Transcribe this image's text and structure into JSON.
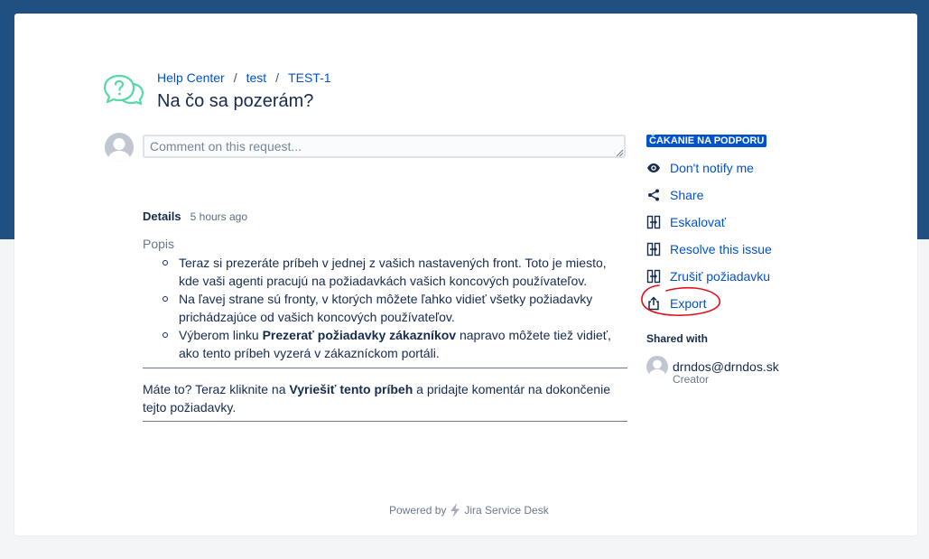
{
  "breadcrumb": {
    "items": [
      "Help Center",
      "test",
      "TEST-1"
    ],
    "separator": "/"
  },
  "page": {
    "title": "Na čo sa pozerám?"
  },
  "comment": {
    "placeholder": "Comment on this request..."
  },
  "details": {
    "title": "Details",
    "time": "5 hours ago",
    "field_label": "Popis",
    "bullets": [
      {
        "text": "Teraz si prezeráte príbeh v jednej z vašich nastavených front. Toto je miesto, kde vaši agenti pracujú na požiadavkách vašich koncových používateľov."
      },
      {
        "text": "Na ľavej strane sú fronty, v ktorých môžete ľahko vidieť všetky požiadavky prichádzajúce od vašich koncových používateľov."
      },
      {
        "before": "Výberom linku ",
        "bold": "Prezerať požiadavky zákazníkov",
        "after": " napravo môžete tiež vidieť, ako tento príbeh vyzerá v zákazníckom portáli."
      }
    ],
    "closing": {
      "before": "Máte to? Teraz kliknite na ",
      "bold": "Vyriešiť tento príbeh",
      "after": " a pridajte komentár na dokončenie tejto požiadavky."
    }
  },
  "sidebar": {
    "status": "ČAKANIE NA PODPORU",
    "actions": [
      {
        "label": "Don't notify me",
        "icon": "eye-icon"
      },
      {
        "label": "Share",
        "icon": "share-icon"
      },
      {
        "label": "Eskalovať",
        "icon": "transition-icon"
      },
      {
        "label": "Resolve this issue",
        "icon": "transition-icon"
      },
      {
        "label": "Zrušiť požiadavku",
        "icon": "transition-icon"
      },
      {
        "label": "Export",
        "icon": "export-icon"
      }
    ],
    "shared_with": {
      "title": "Shared with",
      "email": "drndos@drndos.sk",
      "role": "Creator"
    }
  },
  "footer": {
    "powered_by": "Powered by",
    "product": "Jira Service Desk"
  },
  "colors": {
    "brand": "#205081",
    "link": "#0052cc",
    "status": "#0052cc",
    "annotation": "#e0101b",
    "logo": "#57d9a3"
  }
}
